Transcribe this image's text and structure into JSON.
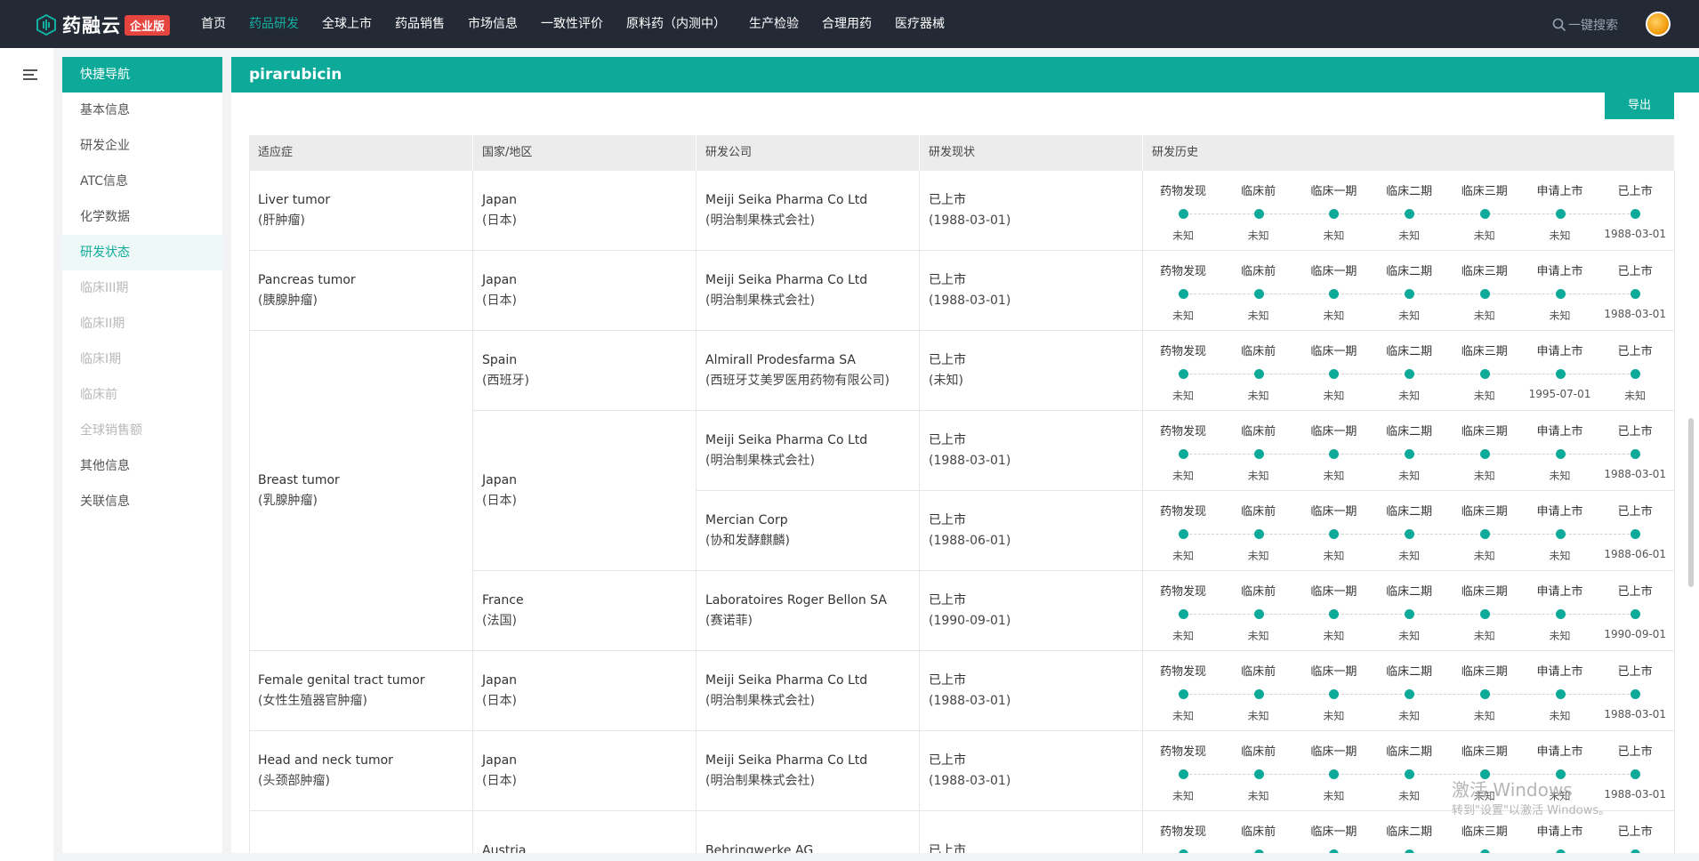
{
  "brand": {
    "name": "药融云",
    "badge": "企业版"
  },
  "nav": [
    {
      "label": "首页",
      "active": false
    },
    {
      "label": "药品研发",
      "active": true
    },
    {
      "label": "全球上市",
      "active": false
    },
    {
      "label": "药品销售",
      "active": false
    },
    {
      "label": "市场信息",
      "active": false
    },
    {
      "label": "一致性评价",
      "active": false
    },
    {
      "label": "原料药（内测中）",
      "active": false
    },
    {
      "label": "生产检验",
      "active": false
    },
    {
      "label": "合理用药",
      "active": false
    },
    {
      "label": "医疗器械",
      "active": false
    }
  ],
  "search": {
    "label": "一键搜索",
    "icon": "search-icon"
  },
  "quick_nav": {
    "title": "快捷导航",
    "items": [
      {
        "label": "基本信息",
        "state": "normal"
      },
      {
        "label": "研发企业",
        "state": "normal"
      },
      {
        "label": "ATC信息",
        "state": "normal"
      },
      {
        "label": "化学数据",
        "state": "normal"
      },
      {
        "label": "研发状态",
        "state": "active"
      },
      {
        "label": "临床III期",
        "state": "disabled"
      },
      {
        "label": "临床II期",
        "state": "disabled"
      },
      {
        "label": "临床I期",
        "state": "disabled"
      },
      {
        "label": "临床前",
        "state": "disabled"
      },
      {
        "label": "全球销售额",
        "state": "disabled"
      },
      {
        "label": "其他信息",
        "state": "normal"
      },
      {
        "label": "关联信息",
        "state": "normal"
      }
    ]
  },
  "panel": {
    "title": "pirarubicin",
    "export_label": "导出"
  },
  "table": {
    "headers": [
      "适应症",
      "国家/地区",
      "研发公司",
      "研发现状",
      "研发历史"
    ],
    "stage_labels": [
      "药物发现",
      "临床前",
      "临床一期",
      "临床二期",
      "临床三期",
      "申请上市",
      "已上市"
    ],
    "indications": [
      {
        "en": "Liver tumor",
        "zh": "(肝肿瘤)",
        "rows": 1
      },
      {
        "en": "Pancreas tumor",
        "zh": "(胰腺肿瘤)",
        "rows": 1
      },
      {
        "en": "Breast tumor",
        "zh": "(乳腺肿瘤)",
        "rows": 4
      },
      {
        "en": "Female genital tract tumor",
        "zh": "(女性生殖器官肿瘤)",
        "rows": 1
      },
      {
        "en": "Head and neck tumor",
        "zh": "(头颈部肿瘤)",
        "rows": 1
      },
      {
        "en": "",
        "zh": "",
        "rows": 1
      }
    ],
    "countries": [
      {
        "en": "Japan",
        "zh": "(日本)",
        "rows": 1
      },
      {
        "en": "Japan",
        "zh": "(日本)",
        "rows": 1
      },
      {
        "en": "Spain",
        "zh": "(西班牙)",
        "rows": 1
      },
      {
        "en": "Japan",
        "zh": "(日本)",
        "rows": 2
      },
      {
        "en": "France",
        "zh": "(法国)",
        "rows": 1
      },
      {
        "en": "Japan",
        "zh": "(日本)",
        "rows": 1
      },
      {
        "en": "Japan",
        "zh": "(日本)",
        "rows": 1
      },
      {
        "en": "Austria",
        "zh": "",
        "rows": 1
      }
    ],
    "rows": [
      {
        "company_en": "Meiji Seika Pharma Co Ltd",
        "company_zh": "(明治制果株式会社)",
        "status": "已上市",
        "status_date": "(1988-03-01)",
        "history": [
          "未知",
          "未知",
          "未知",
          "未知",
          "未知",
          "未知",
          "1988-03-01"
        ]
      },
      {
        "company_en": "Meiji Seika Pharma Co Ltd",
        "company_zh": "(明治制果株式会社)",
        "status": "已上市",
        "status_date": "(1988-03-01)",
        "history": [
          "未知",
          "未知",
          "未知",
          "未知",
          "未知",
          "未知",
          "1988-03-01"
        ]
      },
      {
        "company_en": "Almirall Prodesfarma SA",
        "company_zh": "(西班牙艾美罗医用药物有限公司)",
        "status": "已上市",
        "status_date": "(未知)",
        "history": [
          "未知",
          "未知",
          "未知",
          "未知",
          "未知",
          "1995-07-01",
          "未知"
        ]
      },
      {
        "company_en": "Meiji Seika Pharma Co Ltd",
        "company_zh": "(明治制果株式会社)",
        "status": "已上市",
        "status_date": "(1988-03-01)",
        "history": [
          "未知",
          "未知",
          "未知",
          "未知",
          "未知",
          "未知",
          "1988-03-01"
        ]
      },
      {
        "company_en": "Mercian Corp",
        "company_zh": "(协和发酵麒麟)",
        "status": "已上市",
        "status_date": "(1988-06-01)",
        "history": [
          "未知",
          "未知",
          "未知",
          "未知",
          "未知",
          "未知",
          "1988-06-01"
        ]
      },
      {
        "company_en": "Laboratoires Roger Bellon SA",
        "company_zh": "(赛诺菲)",
        "status": "已上市",
        "status_date": "(1990-09-01)",
        "history": [
          "未知",
          "未知",
          "未知",
          "未知",
          "未知",
          "未知",
          "1990-09-01"
        ]
      },
      {
        "company_en": "Meiji Seika Pharma Co Ltd",
        "company_zh": "(明治制果株式会社)",
        "status": "已上市",
        "status_date": "(1988-03-01)",
        "history": [
          "未知",
          "未知",
          "未知",
          "未知",
          "未知",
          "未知",
          "1988-03-01"
        ]
      },
      {
        "company_en": "Meiji Seika Pharma Co Ltd",
        "company_zh": "(明治制果株式会社)",
        "status": "已上市",
        "status_date": "(1988-03-01)",
        "history": [
          "未知",
          "未知",
          "未知",
          "未知",
          "未知",
          "未知",
          "1988-03-01"
        ]
      },
      {
        "company_en": "Behringwerke AG",
        "company_zh": "",
        "status": "已上市",
        "status_date": "",
        "history": [
          "",
          "",
          "",
          "",
          "",
          "",
          ""
        ]
      }
    ]
  },
  "watermark": {
    "line1": "激活 Windows",
    "line2": "转到\"设置\"以激活 Windows。"
  },
  "colors": {
    "accent": "#0eaa99",
    "topbar": "#232935",
    "badge": "#e5443f"
  }
}
